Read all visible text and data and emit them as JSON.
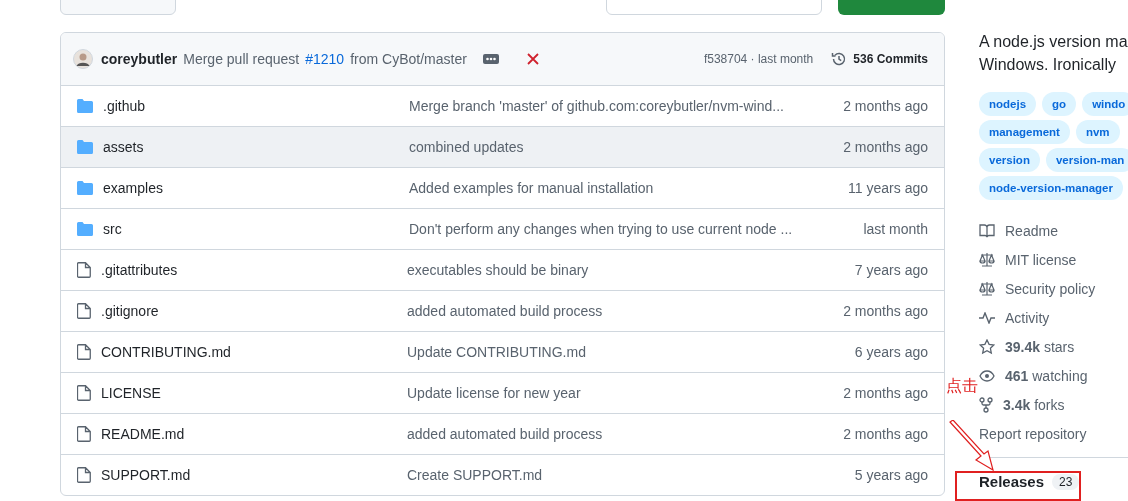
{
  "latest_commit": {
    "author": "coreybutler",
    "message_before": "Merge pull request",
    "pr_link": "#1210",
    "message_after": "from CyBot/master",
    "failed": true,
    "hash_time": "f538704 · last month",
    "commits": "536 Commits"
  },
  "files": [
    {
      "kind": "folder",
      "name": ".github",
      "message": "Merge branch 'master' of github.com:coreybutler/nvm-wind...",
      "time": "2 months ago",
      "highlighted": false
    },
    {
      "kind": "folder",
      "name": "assets",
      "message": "combined updates",
      "time": "2 months ago",
      "highlighted": true
    },
    {
      "kind": "folder",
      "name": "examples",
      "message": "Added examples for manual installation",
      "time": "11 years ago",
      "highlighted": false
    },
    {
      "kind": "folder",
      "name": "src",
      "message": "Don't perform any changes when trying to use current node ...",
      "time": "last month",
      "highlighted": false
    },
    {
      "kind": "file",
      "name": ".gitattributes",
      "message": "executables should be binary",
      "time": "7 years ago",
      "highlighted": false
    },
    {
      "kind": "file",
      "name": ".gitignore",
      "message": "added automated build process",
      "time": "2 months ago",
      "highlighted": false
    },
    {
      "kind": "file",
      "name": "CONTRIBUTING.md",
      "message": "Update CONTRIBUTING.md",
      "time": "6 years ago",
      "highlighted": false
    },
    {
      "kind": "file",
      "name": "LICENSE",
      "message": "Update license for new year",
      "time": "2 months ago",
      "highlighted": false
    },
    {
      "kind": "file",
      "name": "README.md",
      "message": "added automated build process",
      "time": "2 months ago",
      "highlighted": false
    },
    {
      "kind": "file",
      "name": "SUPPORT.md",
      "message": "Create SUPPORT.md",
      "time": "5 years ago",
      "highlighted": false
    }
  ],
  "about": {
    "description_lines": [
      "A node.js version ma",
      "Windows. Ironically"
    ],
    "topics": [
      [
        "nodejs",
        "go",
        "windo"
      ],
      [
        "management",
        "nvm"
      ],
      [
        "version",
        "version-man"
      ],
      [
        "node-version-manager"
      ]
    ],
    "links": [
      {
        "kind": "book",
        "text": "Readme"
      },
      {
        "kind": "scale",
        "text": "MIT license"
      },
      {
        "kind": "scale",
        "text": "Security policy"
      },
      {
        "kind": "pulse",
        "text": "Activity"
      },
      {
        "kind": "star",
        "text": "**39.4k** stars"
      },
      {
        "kind": "eye",
        "text": "**461** watching"
      },
      {
        "kind": "fork",
        "text": "**3.4k** forks"
      },
      {
        "kind": "plain",
        "text": "Report repository"
      }
    ]
  },
  "releases": {
    "title": "Releases",
    "count": "23"
  },
  "annotation": {
    "text": "点击"
  }
}
